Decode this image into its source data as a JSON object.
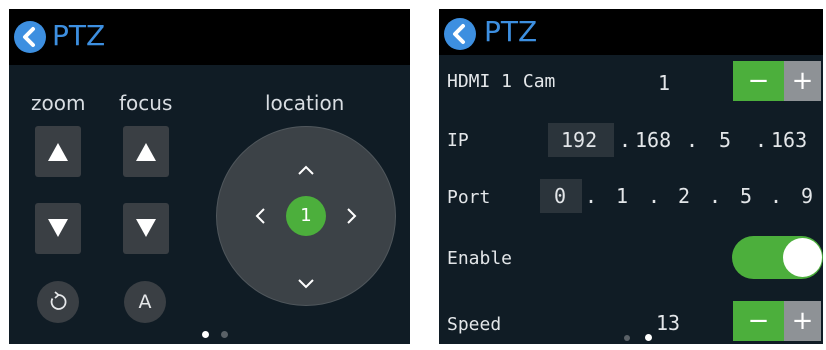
{
  "left_panel": {
    "title": "PTZ",
    "labels": {
      "zoom": "zoom",
      "focus": "focus",
      "location": "location"
    },
    "zoom_in_icon": "triangle-up-icon",
    "zoom_out_icon": "triangle-down-icon",
    "focus_in_icon": "triangle-up-icon",
    "focus_out_icon": "triangle-down-icon",
    "reset_icon": "rotate-ccw-icon",
    "autofocus_label": "A",
    "joystick_center_label": "1",
    "page_dots": {
      "count": 2,
      "active": 0
    }
  },
  "right_panel": {
    "title": "PTZ",
    "hdmi_label": "HDMI 1 Cam",
    "hdmi_value": "1",
    "ip_label": "IP",
    "ip_octets": [
      "192",
      "168",
      "5",
      "163"
    ],
    "ip_separator": ".",
    "port_label": "Port",
    "port_digits": [
      "0",
      "1",
      "2",
      "5",
      "9"
    ],
    "port_separator": ".",
    "enable_label": "Enable",
    "enable_on": true,
    "speed_label": "Speed",
    "speed_value": "13",
    "minus_label": "−",
    "plus_label": "+",
    "page_dots": {
      "count": 2,
      "active": 1
    }
  },
  "colors": {
    "panel_bg": "#101c25",
    "header_bg": "#000000",
    "accent_blue": "#3d8fe0",
    "accent_green": "#4caf3c",
    "button_gray": "#3a3f44"
  }
}
